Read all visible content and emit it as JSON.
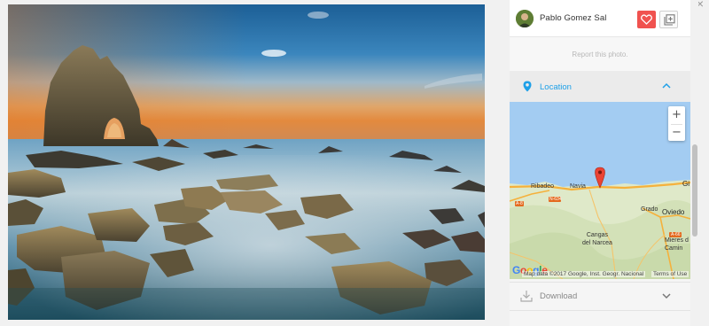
{
  "user": {
    "name": "Pablo Gomez Sal"
  },
  "actions": {
    "like_icon": "heart-icon",
    "add_icon": "add-to-collection-icon",
    "like_color": "#f0524f"
  },
  "report": {
    "label": "Report this photo."
  },
  "location": {
    "label": "Location",
    "accent": "#1ea0e8"
  },
  "map": {
    "zoom_in": "+",
    "zoom_out": "−",
    "google": "Google",
    "attribution": "Map data ©2017 Google, Inst. Geogr. Nacional",
    "terms": "Terms of Use",
    "places": {
      "ribadeo": "Ribadeo",
      "navia": "Navia",
      "gijon": "Gi",
      "grado": "Grado",
      "oviedo": "Oviedo",
      "cangas": "Cangas\ndel Narcea",
      "mieres": "Mieres d\nCamin"
    },
    "road_labels": {
      "a8": "A-8",
      "n634": "N-634",
      "a66": "A-66"
    }
  },
  "download": {
    "label": "Download"
  },
  "window": {
    "close": "×"
  }
}
